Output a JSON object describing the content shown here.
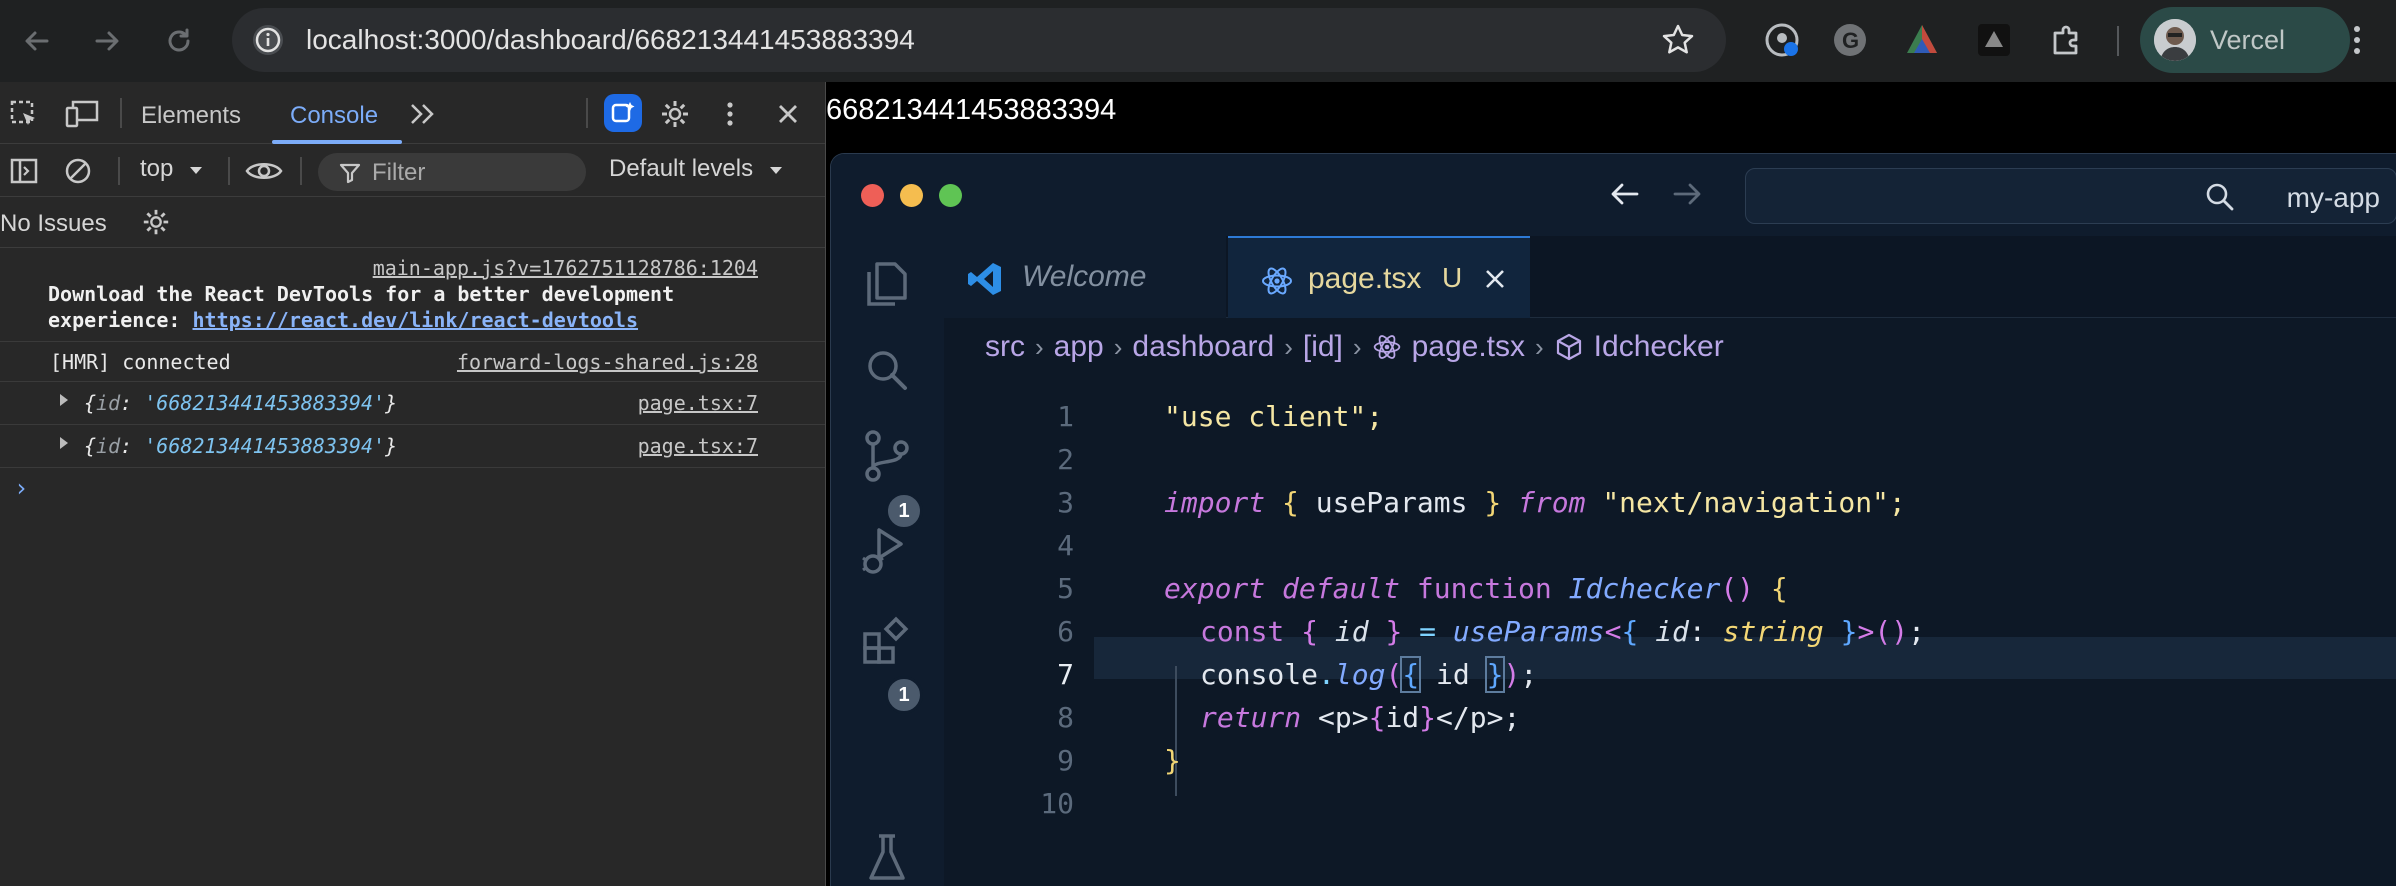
{
  "browser": {
    "url": "localhost:3000/dashboard/668213441453883394",
    "profile_name": "Vercel",
    "icons": [
      "back-icon",
      "forward-icon",
      "reload-icon",
      "site-info-icon",
      "bookmark-star-icon",
      "extension-icon",
      "menu-icon"
    ]
  },
  "devtools": {
    "tabs": [
      "Elements",
      "Console"
    ],
    "active_tab": "Console",
    "context": "top",
    "filter_placeholder": "Filter",
    "levels": "Default levels",
    "issues": "No Issues",
    "messages": [
      {
        "source": "main-app.js?v=1762751128786:1204",
        "line1": "Download the React DevTools for a better development",
        "line2_prefix": "experience: ",
        "link": "https://react.dev/link/react-devtools"
      },
      {
        "text": "[HMR] connected",
        "source": "forward-logs-shared.js:28"
      },
      {
        "key": "id",
        "value": "'668213441453883394'",
        "source": "page.tsx:7"
      },
      {
        "key": "id",
        "value": "'668213441453883394'",
        "source": "page.tsx:7"
      }
    ],
    "prompt": "›"
  },
  "page": {
    "text": "668213441453883394"
  },
  "vscode": {
    "search_label": "my-app",
    "tabs": [
      {
        "label": "Welcome"
      },
      {
        "label": "page.tsx",
        "status": "U"
      }
    ],
    "breadcrumb": [
      "src",
      "app",
      "dashboard",
      "[id]",
      "page.tsx",
      "Idchecker"
    ],
    "badges": {
      "scm": "1",
      "extensions": "1"
    },
    "line_numbers": [
      "1",
      "2",
      "3",
      "4",
      "5",
      "6",
      "7",
      "8",
      "9",
      "10"
    ],
    "current_line": "7",
    "code": {
      "l1": "\"use client\";",
      "l3_import": "import",
      "l3_open": "{",
      "l3_name": " useParams ",
      "l3_close": "}",
      "l3_from": "from",
      "l3_str": "\"next/navigation\";",
      "l5_export": "export",
      "l5_default": "default",
      "l5_function": "function",
      "l5_name": "Idchecker",
      "l5_parens": "()",
      "l5_brace": "{",
      "l6_const": "const",
      "l6_open": "{",
      "l6_id": "id",
      "l6_close": "}",
      "l6_eq": "=",
      "l6_fn": "useParams",
      "l6_lt": "<",
      "l6_topen": "{",
      "l6_tid": "id",
      "l6_colon": ":",
      "l6_type": "string",
      "l6_tclose": "}",
      "l6_gt": ">",
      "l6_call": "()",
      "l6_semi": ";",
      "l7_obj": "console",
      "l7_dot": ".",
      "l7_fn": "log",
      "l7_po": "(",
      "l7_bo": "{",
      "l7_id": " id ",
      "l7_bc": "}",
      "l7_pc": ")",
      "l7_semi": ";",
      "l8_return": "return",
      "l8_tag1": "<p>",
      "l8_bo": "{",
      "l8_id": "id",
      "l8_bc": "}",
      "l8_tag2": "</p>",
      "l8_semi": ";",
      "l9": "}"
    }
  },
  "colors": {
    "accent": "#7cacf8",
    "vscode_bg": "#0d1826",
    "devtools_bg": "#282828"
  }
}
